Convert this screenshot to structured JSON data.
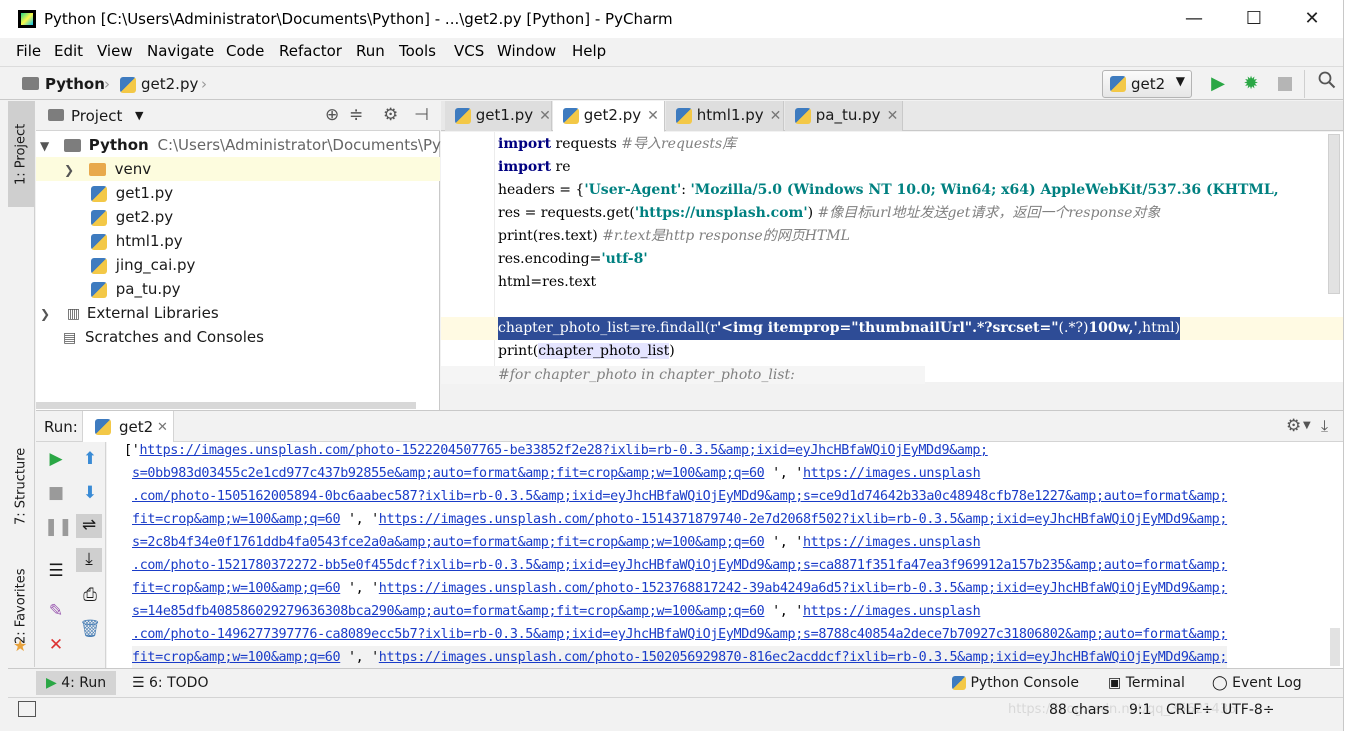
{
  "window": {
    "title": "Python [C:\\Users\\Administrator\\Documents\\Python] - ...\\get2.py [Python] - PyCharm",
    "minimize": "—",
    "maximize": "☐",
    "close": "✕"
  },
  "menu": [
    "File",
    "Edit",
    "View",
    "Navigate",
    "Code",
    "Refactor",
    "Run",
    "Tools",
    "VCS",
    "Window",
    "Help"
  ],
  "breadcrumb": {
    "project": "Python",
    "file": "get2.py"
  },
  "toolbar": {
    "run_config": "get2",
    "run_icon": "play-icon",
    "debug_icon": "bug-icon",
    "stop_icon": "stop-icon",
    "search_icon": "search-icon"
  },
  "left_stripe": {
    "project": "1: Project",
    "structure": "7: Structure",
    "favorites": "2: Favorites"
  },
  "project_panel": {
    "title": "Project",
    "root_name": "Python",
    "root_path": "C:\\Users\\Administrator\\Documents\\Pyth",
    "items": [
      {
        "name": "venv",
        "type": "folder"
      },
      {
        "name": "get1.py",
        "type": "py"
      },
      {
        "name": "get2.py",
        "type": "py"
      },
      {
        "name": "html1.py",
        "type": "py"
      },
      {
        "name": "jing_cai.py",
        "type": "py"
      },
      {
        "name": "pa_tu.py",
        "type": "py"
      }
    ],
    "external": "External Libraries",
    "scratches": "Scratches and Consoles"
  },
  "editor_tabs": [
    {
      "label": "get1.py",
      "active": false
    },
    {
      "label": "get2.py",
      "active": true
    },
    {
      "label": "html1.py",
      "active": false
    },
    {
      "label": "pa_tu.py",
      "active": false
    }
  ],
  "code": {
    "l1": {
      "kw": "import",
      "rest": " requests ",
      "cm": "#导入requests库"
    },
    "l2": {
      "kw": "import",
      "rest": " re"
    },
    "l3": {
      "pre": "headers = {",
      "s1": "'User-Agent'",
      "mid": ": ",
      "s2": "'Mozilla/5.0 (Windows NT 10.0; Win64; x64) AppleWebKit/537.36 (KHTML,"
    },
    "l4": {
      "pre": "res = requests.get(",
      "s1": "'https://unsplash.com'",
      "mid": ") ",
      "cm": "#像目标url地址发送get请求，返回一个response对象"
    },
    "l5": {
      "pre": "print(res.text) ",
      "cm": "#r.text是http response的网页HTML"
    },
    "l6": {
      "pre": "res.encoding=",
      "s1": "'utf-8'"
    },
    "l7": {
      "pre": "html=res.text"
    },
    "l8": {
      "pre": "chapter_photo_list=re.findall(r",
      "s1": "'<img itemprop=\"thumbnailUrl\".*?srcset=\"",
      "mid": "(.*?)",
      "s2": "100w,'",
      "post": ",html)"
    },
    "l9": {
      "pre": "print(",
      "mid": "chapter_photo_list",
      "post": ")"
    },
    "l10": {
      "cm": "#for chapter_photo in chapter_photo_list:"
    }
  },
  "run_panel": {
    "label": "Run:",
    "tab": "get2",
    "lines": [
      {
        "t": "['",
        "l": "https://images.unsplash.com/photo-1522204507765-be33852f2e28?ixlib=rb-0.3.5&amp;ixid=eyJhcHBfaWQiOjEyMDd9&amp;"
      },
      {
        "l": "s=0bb983d03455c2e1cd977c437b92855e&amp;auto=format&amp;fit=crop&amp;w=100&amp;q=60",
        "t": " ', '",
        "l2": "https://images.unsplash"
      },
      {
        "l": ".com/photo-1505162005894-0bc6aabec587?ixlib=rb-0.3.5&amp;ixid=eyJhcHBfaWQiOjEyMDd9&amp;s=ce9d1d74642b33a0c48948cfb78e1227&amp;auto=format&amp;"
      },
      {
        "l": "fit=crop&amp;w=100&amp;q=60",
        "t": " ', '",
        "l2": "https://images.unsplash.com/photo-1514371879740-2e7d2068f502?ixlib=rb-0.3.5&amp;ixid=eyJhcHBfaWQiOjEyMDd9&amp;"
      },
      {
        "l": "s=2c8b4f34e0f1761ddb4fa0543fce2a0a&amp;auto=format&amp;fit=crop&amp;w=100&amp;q=60",
        "t": " ', '",
        "l2": "https://images.unsplash"
      },
      {
        "l": ".com/photo-1521780372272-bb5e0f455dcf?ixlib=rb-0.3.5&amp;ixid=eyJhcHBfaWQiOjEyMDd9&amp;s=ca8871f351fa47ea3f969912a157b235&amp;auto=format&amp;"
      },
      {
        "l": "fit=crop&amp;w=100&amp;q=60",
        "t": " ', '",
        "l2": "https://images.unsplash.com/photo-1523768817242-39ab4249a6d5?ixlib=rb-0.3.5&amp;ixid=eyJhcHBfaWQiOjEyMDd9&amp;"
      },
      {
        "l": "s=14e85dfb408586029279636308bca290&amp;auto=format&amp;fit=crop&amp;w=100&amp;q=60",
        "t": " ', '",
        "l2": "https://images.unsplash"
      },
      {
        "l": ".com/photo-1496277397776-ca8089ecc5b7?ixlib=rb-0.3.5&amp;ixid=eyJhcHBfaWQiOjEyMDd9&amp;s=8788c40854a2dece7b70927c31806802&amp;auto=format&amp;"
      },
      {
        "l": "fit=crop&amp;w=100&amp;q=60",
        "t": " ', '",
        "l2": "https://images.unsplash.com/photo-1502056929870-816ec2acddcf?ixlib=rb-0.3.5&amp;ixid=eyJhcHBfaWQiOjEyMDd9&amp;"
      }
    ]
  },
  "bottom_tabs": {
    "run": "4: Run",
    "todo": "6: TODO",
    "python_console": "Python Console",
    "terminal": "Terminal",
    "event_log": "Event Log"
  },
  "status": {
    "chars": "88 chars",
    "pos": "9:1",
    "crlf": "CRLF÷",
    "enc": "UTF-8÷",
    "watermark": "https://blog.csdn.net/qq_35621436"
  },
  "colors": {
    "keyword": "#000080",
    "string": "#008080",
    "comment": "#808080",
    "selection": "#2e4c96",
    "link": "#1a3cc8",
    "run_green": "#2aa745"
  }
}
